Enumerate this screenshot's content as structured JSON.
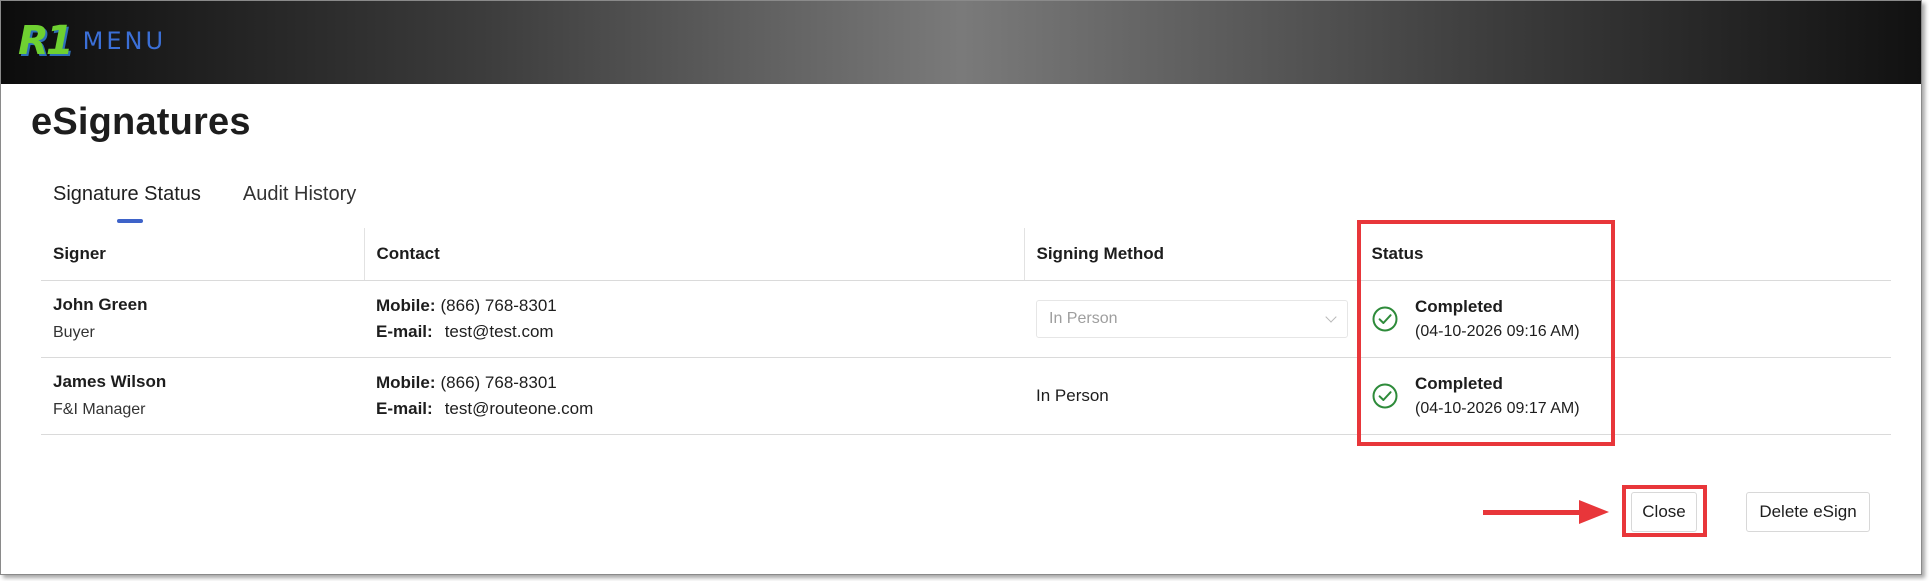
{
  "header": {
    "logo_mark": "R1",
    "logo_text": "MENU"
  },
  "page": {
    "title": "eSignatures"
  },
  "tabs": [
    {
      "label": "Signature Status",
      "active": true
    },
    {
      "label": "Audit History",
      "active": false
    }
  ],
  "table": {
    "columns": [
      "Signer",
      "Contact",
      "Signing Method",
      "Status"
    ],
    "rows": [
      {
        "signer_name": "John Green",
        "signer_role": "Buyer",
        "mobile_label": "Mobile:",
        "mobile": "(866) 768-8301",
        "email_label": "E-mail:",
        "email": "test@test.com",
        "signing_method": "In Person",
        "signing_method_disabled_select": true,
        "status": "Completed",
        "status_time": "(04-10-2026 09:16 AM)"
      },
      {
        "signer_name": "James Wilson",
        "signer_role": "F&I Manager",
        "mobile_label": "Mobile:",
        "mobile": "(866) 768-8301",
        "email_label": "E-mail:",
        "email": "test@routeone.com",
        "signing_method": "In Person",
        "signing_method_disabled_select": false,
        "status": "Completed",
        "status_time": "(04-10-2026 09:17 AM)"
      }
    ]
  },
  "actions": {
    "close_label": "Close",
    "delete_label": "Delete eSign"
  },
  "icons": {
    "status_icon": "check-circle-icon",
    "select_icon": "chevron-down-icon"
  },
  "colors": {
    "accent_tab": "#3e63c9",
    "status_success": "#2e8b3a",
    "highlight": "#e8363a",
    "logo_green": "#6fd031",
    "logo_blue": "#3b6fd6"
  }
}
